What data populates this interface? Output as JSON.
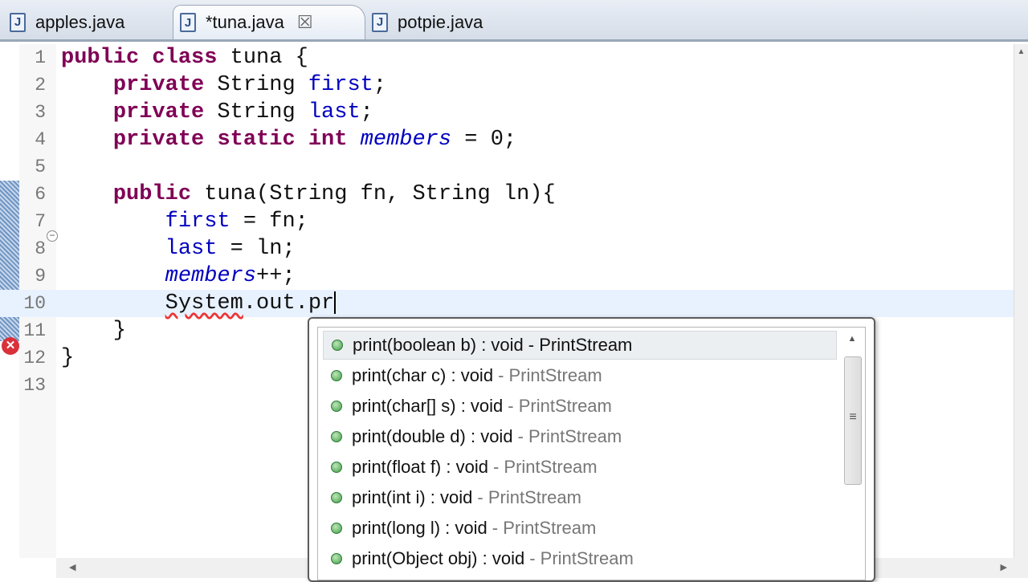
{
  "tabs": [
    {
      "label": "apples.java",
      "icon": "java-file-icon"
    },
    {
      "label": "*tuna.java",
      "icon": "java-file-icon",
      "active": true,
      "close": "☒"
    },
    {
      "label": "potpie.java",
      "icon": "java-file-icon"
    }
  ],
  "tab_icon_glyph": "J",
  "lines": [
    {
      "n": "1",
      "tokens": [
        [
          "public",
          "kw"
        ],
        [
          " ",
          ""
        ],
        [
          "class",
          "kw"
        ],
        [
          " tuna {",
          ""
        ]
      ]
    },
    {
      "n": "2",
      "tokens": [
        [
          "    ",
          ""
        ],
        [
          "private",
          "kw"
        ],
        [
          " String ",
          ""
        ],
        [
          "first",
          "fld"
        ],
        [
          ";",
          ""
        ]
      ]
    },
    {
      "n": "3",
      "tokens": [
        [
          "    ",
          ""
        ],
        [
          "private",
          "kw"
        ],
        [
          " String ",
          ""
        ],
        [
          "last",
          "fld"
        ],
        [
          ";",
          ""
        ]
      ]
    },
    {
      "n": "4",
      "tokens": [
        [
          "    ",
          ""
        ],
        [
          "private",
          "kw"
        ],
        [
          " ",
          ""
        ],
        [
          "static",
          "kw"
        ],
        [
          " ",
          ""
        ],
        [
          "int",
          "kw"
        ],
        [
          " ",
          ""
        ],
        [
          "members",
          "sfld"
        ],
        [
          " = 0;",
          ""
        ]
      ]
    },
    {
      "n": "5",
      "tokens": []
    },
    {
      "n": "6",
      "tokens": [
        [
          "    ",
          ""
        ],
        [
          "public",
          "kw"
        ],
        [
          " tuna(String fn, String ln){",
          ""
        ]
      ]
    },
    {
      "n": "7",
      "tokens": [
        [
          "        ",
          ""
        ],
        [
          "first",
          "fld"
        ],
        [
          " = fn;",
          ""
        ]
      ]
    },
    {
      "n": "8",
      "tokens": [
        [
          "        ",
          ""
        ],
        [
          "last",
          "fld"
        ],
        [
          " = ln;",
          ""
        ]
      ]
    },
    {
      "n": "9",
      "tokens": [
        [
          "        ",
          ""
        ],
        [
          "members",
          "sfld"
        ],
        [
          "++;",
          ""
        ]
      ]
    },
    {
      "n": "10",
      "tokens": [
        [
          "        ",
          ""
        ],
        [
          "System",
          "err"
        ],
        [
          ".out.pr",
          ""
        ]
      ]
    },
    {
      "n": "11",
      "tokens": [
        [
          "    }",
          ""
        ]
      ]
    },
    {
      "n": "12",
      "tokens": [
        [
          "}",
          ""
        ]
      ]
    },
    {
      "n": "13",
      "tokens": []
    }
  ],
  "current_line": 10,
  "error_icon": "✕",
  "fold_icon": "−",
  "completions": [
    {
      "sig": "print(boolean b) : void",
      "owner": "- PrintStream"
    },
    {
      "sig": "print(char c) : void",
      "owner": "- PrintStream"
    },
    {
      "sig": "print(char[] s) : void",
      "owner": "- PrintStream"
    },
    {
      "sig": "print(double d) : void",
      "owner": "- PrintStream"
    },
    {
      "sig": "print(float f) : void",
      "owner": "- PrintStream"
    },
    {
      "sig": "print(int i) : void",
      "owner": "- PrintStream"
    },
    {
      "sig": "print(long l) : void",
      "owner": "- PrintStream"
    },
    {
      "sig": "print(Object obj) : void",
      "owner": "- PrintStream"
    }
  ],
  "scroll": {
    "up": "▲",
    "grip": "≡",
    "left": "◀",
    "right": "▶"
  }
}
